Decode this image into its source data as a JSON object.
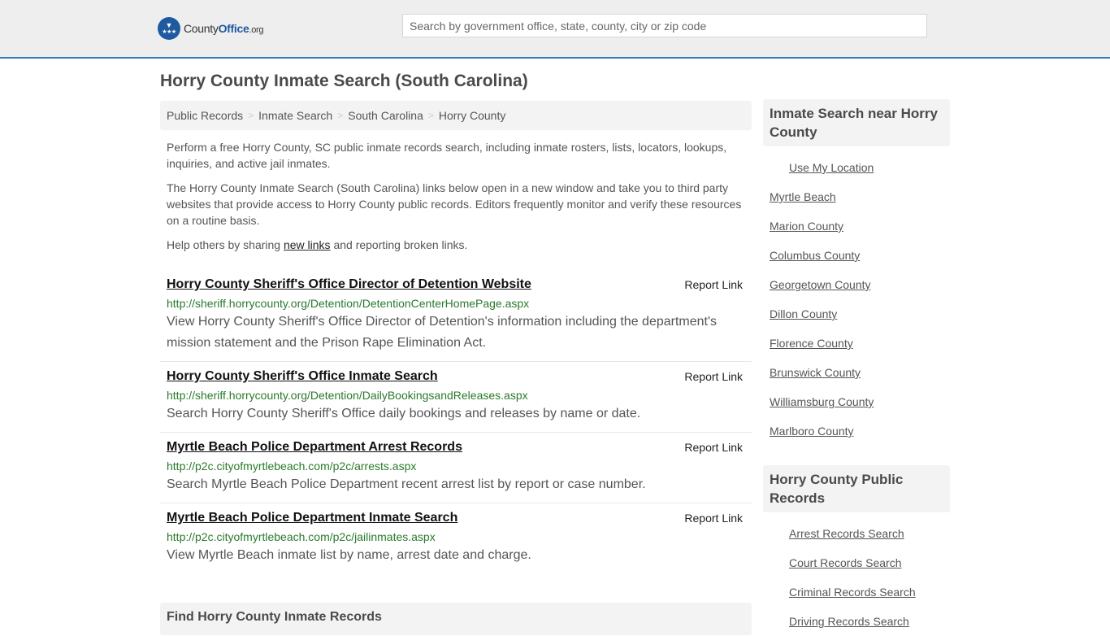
{
  "header": {
    "logo": {
      "county": "County",
      "office": "Office",
      "org": ".org"
    },
    "search_placeholder": "Search by government office, state, county, city or zip code"
  },
  "page_title": "Horry County Inmate Search (South Carolina)",
  "breadcrumb": [
    "Public Records",
    "Inmate Search",
    "South Carolina",
    "Horry County"
  ],
  "intro": {
    "p1": "Perform a free Horry County, SC public inmate records search, including inmate rosters, lists, locators, lookups, inquiries, and active jail inmates.",
    "p2": "The Horry County Inmate Search (South Carolina) links below open in a new window and take you to third party websites that provide access to Horry County public records. Editors frequently monitor and verify these resources on a routine basis.",
    "p3_before": "Help others by sharing ",
    "p3_link": "new links",
    "p3_after": " and reporting broken links."
  },
  "results": [
    {
      "title": "Horry County Sheriff's Office Director of Detention Website",
      "url": "http://sheriff.horrycounty.org/Detention/DetentionCenterHomePage.aspx",
      "description": "View Horry County Sheriff's Office Director of Detention's information including the department's mission statement and the Prison Rape Elimination Act.",
      "report_label": "Report Link"
    },
    {
      "title": "Horry County Sheriff's Office Inmate Search",
      "url": "http://sheriff.horrycounty.org/Detention/DailyBookingsandReleases.aspx",
      "description": "Search Horry County Sheriff's Office daily bookings and releases by name or date.",
      "report_label": "Report Link"
    },
    {
      "title": "Myrtle Beach Police Department Arrest Records",
      "url": "http://p2c.cityofmyrtlebeach.com/p2c/arrests.aspx",
      "description": "Search Myrtle Beach Police Department recent arrest list by report or case number.",
      "report_label": "Report Link"
    },
    {
      "title": "Myrtle Beach Police Department Inmate Search",
      "url": "http://p2c.cityofmyrtlebeach.com/p2c/jailinmates.aspx",
      "description": "View Myrtle Beach inmate list by name, arrest date and charge.",
      "report_label": "Report Link"
    }
  ],
  "find_heading": "Find Horry County Inmate Records",
  "sidebar": {
    "nearby": {
      "heading": "Inmate Search near Horry County",
      "use_location": "Use My Location",
      "items": [
        "Myrtle Beach",
        "Marion County",
        "Columbus County",
        "Georgetown County",
        "Dillon County",
        "Florence County",
        "Brunswick County",
        "Williamsburg County",
        "Marlboro County"
      ]
    },
    "public_records": {
      "heading": "Horry County Public Records",
      "items": [
        "Arrest Records Search",
        "Court Records Search",
        "Criminal Records Search",
        "Driving Records Search"
      ]
    }
  },
  "colors": {
    "accent": "#337ab7",
    "brand": "#1f5aa0",
    "url_green": "#2a7a2a"
  }
}
